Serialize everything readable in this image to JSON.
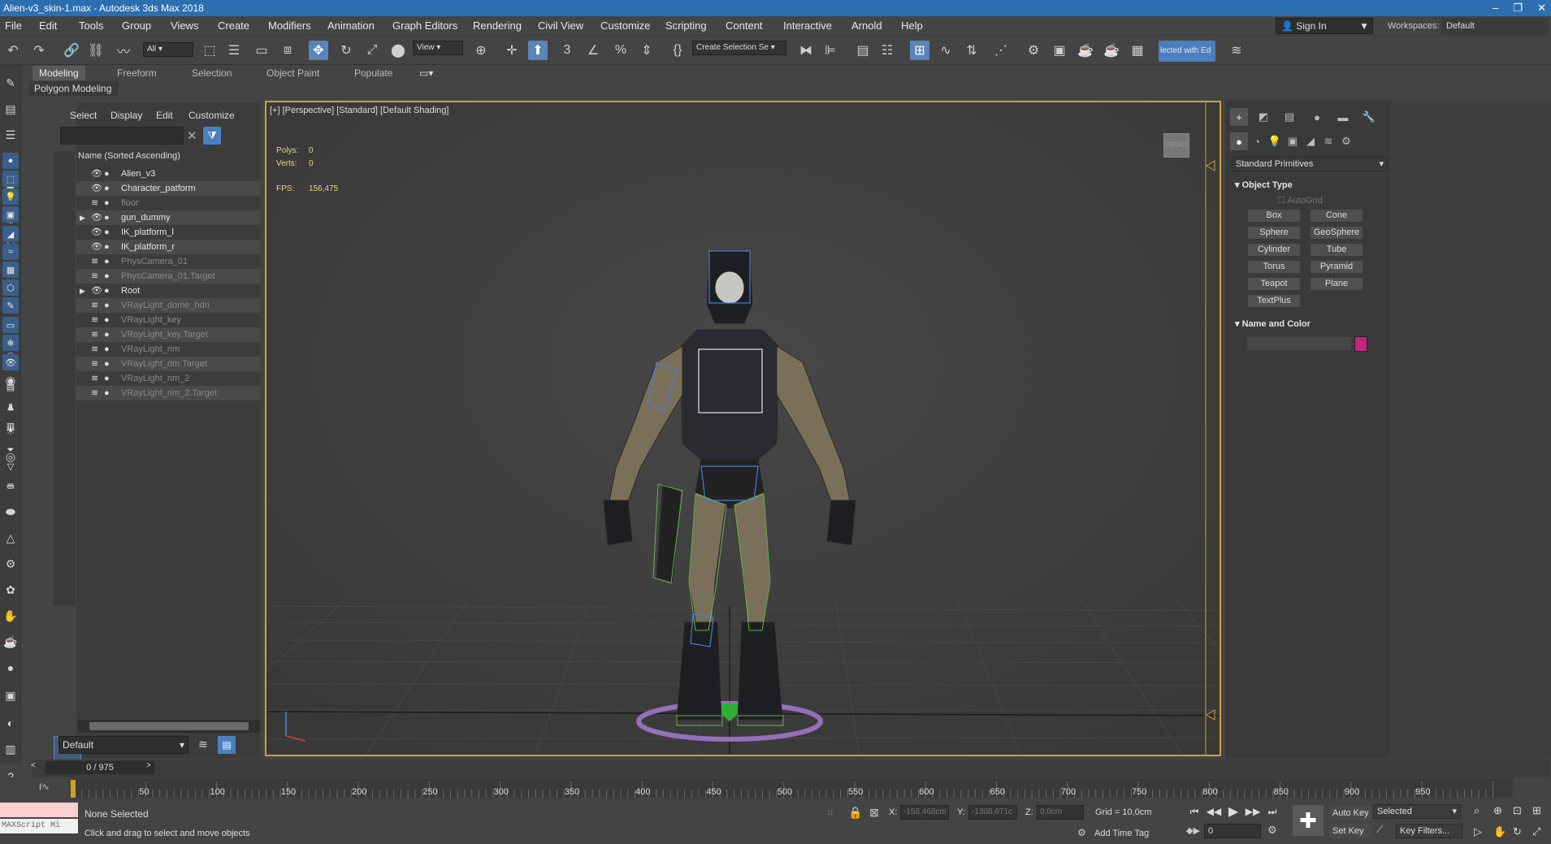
{
  "window": {
    "title": "Alien-v3_skin-1.max - Autodesk 3ds Max 2018",
    "controls": [
      "–",
      "❐",
      "✕"
    ]
  },
  "menu": [
    "File",
    "Edit",
    "Tools",
    "Group",
    "Views",
    "Create",
    "Modifiers",
    "Animation",
    "Graph Editors",
    "Rendering",
    "Civil View",
    "Customize",
    "Scripting",
    "Content",
    "Interactive",
    "Arnold",
    "Help"
  ],
  "account": {
    "sign_in": "Sign In",
    "workspaces_label": "Workspaces:",
    "workspace": "Default"
  },
  "toolbar": {
    "filter": "All",
    "ref_coord": "View",
    "selection_set": "Create Selection Se",
    "scene_explorer_button": "lected with Ed"
  },
  "ribbon": {
    "tabs": [
      "Modeling",
      "Freeform",
      "Selection",
      "Object Paint",
      "Populate"
    ],
    "active_tab": "Modeling",
    "panel": "Polygon Modeling"
  },
  "scene_explorer": {
    "tabs": [
      "Select",
      "Display",
      "Edit",
      "Customize"
    ],
    "column_header": "Name (Sorted Ascending)",
    "items": [
      {
        "name": "Alien_v3",
        "dim": false,
        "expand": ""
      },
      {
        "name": "Character_patform",
        "dim": false,
        "expand": ""
      },
      {
        "name": "floor",
        "dim": true,
        "expand": ""
      },
      {
        "name": "gun_dummy",
        "dim": false,
        "expand": "▶"
      },
      {
        "name": "IK_platform_l",
        "dim": false,
        "expand": ""
      },
      {
        "name": "IK_platform_r",
        "dim": false,
        "expand": ""
      },
      {
        "name": "PhysCamera_01",
        "dim": true,
        "expand": ""
      },
      {
        "name": "PhysCamera_01.Target",
        "dim": true,
        "expand": ""
      },
      {
        "name": "Root",
        "dim": false,
        "expand": "▶"
      },
      {
        "name": "VRayLight_dome_hdri",
        "dim": true,
        "expand": ""
      },
      {
        "name": "VRayLight_key",
        "dim": true,
        "expand": ""
      },
      {
        "name": "VRayLight_key.Target",
        "dim": true,
        "expand": ""
      },
      {
        "name": "VRayLight_rim",
        "dim": true,
        "expand": ""
      },
      {
        "name": "VRayLight_rim.Target",
        "dim": true,
        "expand": ""
      },
      {
        "name": "VRayLight_rim_2",
        "dim": true,
        "expand": ""
      },
      {
        "name": "VRayLight_rim_2.Target",
        "dim": true,
        "expand": ""
      }
    ],
    "layer": "Default"
  },
  "viewport": {
    "label": "[+] [Perspective] [Standard] [Default Shading]",
    "polys_label": "Polys:",
    "polys": "0",
    "verts_label": "Verts:",
    "verts": "0",
    "fps_label": "FPS:",
    "fps": "156,475",
    "viewcube": "FRONT"
  },
  "command_panel": {
    "dropdown": "Standard Primitives",
    "object_type_title": "Object Type",
    "autogrid": "AutoGrid",
    "primitives": [
      "Box",
      "Cone",
      "Sphere",
      "GeoSphere",
      "Cylinder",
      "Tube",
      "Torus",
      "Pyramid",
      "Teapot",
      "Plane",
      "TextPlus"
    ],
    "name_color_title": "Name and Color",
    "object_color": "#c4257d"
  },
  "timeline": {
    "frame_display": "0 / 975",
    "ticks": [
      "50",
      "100",
      "150",
      "200",
      "250",
      "300",
      "350",
      "400",
      "450",
      "500",
      "550",
      "600",
      "650",
      "700",
      "750",
      "800",
      "850",
      "900",
      "950"
    ]
  },
  "status": {
    "maxscript_label": "MAXScript Mi",
    "selection": "None Selected",
    "prompt": "Click and drag to select and move objects",
    "x_label": "X:",
    "x_value": "-158,468cm",
    "y_label": "Y:",
    "y_value": "-1308,671c",
    "z_label": "Z:",
    "z_value": "0,0cm",
    "grid": "Grid = 10,0cm",
    "add_time_tag": "Add Time Tag",
    "current_frame": "0",
    "auto_key": "Auto Key",
    "set_key": "Set Key",
    "key_mode": "Selected",
    "key_filters": "Key Filters..."
  }
}
